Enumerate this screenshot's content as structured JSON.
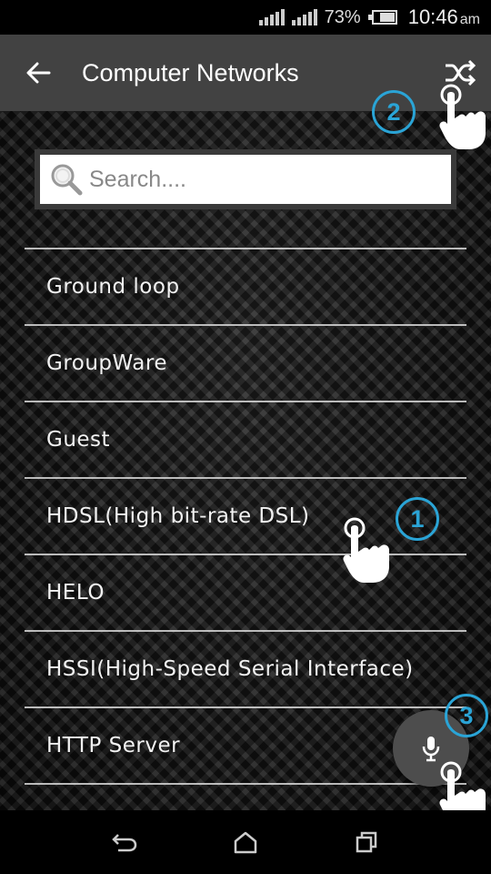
{
  "status_bar": {
    "battery_percent": "73%",
    "battery_level": 0.73,
    "time": "10:46",
    "ampm": "am"
  },
  "app_bar": {
    "title": "Computer Networks",
    "back_icon": "arrow-back-icon",
    "action_icon": "shuffle-icon"
  },
  "search": {
    "placeholder": "Search....",
    "value": "",
    "icon": "magnifier-icon"
  },
  "terms": [
    {
      "label": "Ground loop"
    },
    {
      "label": "GroupWare"
    },
    {
      "label": "Guest"
    },
    {
      "label": "HDSL(High bit-rate DSL)"
    },
    {
      "label": "HELO"
    },
    {
      "label": "HSSI(High-Speed Serial Interface)"
    },
    {
      "label": "HTTP Server"
    }
  ],
  "mic_button": {
    "icon": "microphone-icon"
  },
  "tutorial": {
    "steps": [
      "1",
      "2",
      "3"
    ],
    "accent_color": "#2aa4d6"
  },
  "nav_bar": {
    "back_icon": "nav-back-icon",
    "home_icon": "nav-home-icon",
    "recents_icon": "nav-recents-icon"
  },
  "colors": {
    "app_bar": "#424242",
    "status_bar": "#000000",
    "divider": "#d8d8d8",
    "fab": "#4d4d4d"
  }
}
